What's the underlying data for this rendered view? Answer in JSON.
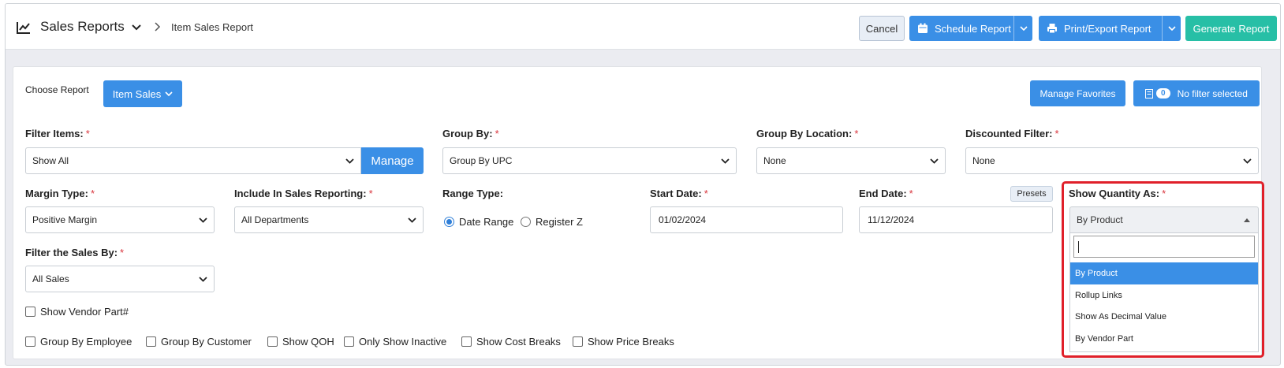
{
  "header": {
    "title": "Sales Reports",
    "breadcrumb": "Item Sales Report",
    "cancel_label": "Cancel",
    "schedule_label": "Schedule Report",
    "print_label": "Print/Export Report",
    "generate_label": "Generate Report"
  },
  "toolbar": {
    "choose_report_label": "Choose Report",
    "report_button": "Item Sales",
    "manage_favorites": "Manage Favorites",
    "filter_count": "0",
    "filter_status": "No filter selected"
  },
  "fields": {
    "filter_items": {
      "label": "Filter Items:",
      "value": "Show All",
      "manage": "Manage"
    },
    "group_by": {
      "label": "Group By:",
      "value": "Group By UPC"
    },
    "group_by_location": {
      "label": "Group By Location:",
      "value": "None"
    },
    "discounted_filter": {
      "label": "Discounted Filter:",
      "value": "None"
    },
    "margin_type": {
      "label": "Margin Type:",
      "value": "Positive Margin"
    },
    "include_in_sales": {
      "label": "Include In Sales Reporting:",
      "value": "All Departments"
    },
    "range_type": {
      "label": "Range Type:",
      "options": [
        "Date Range",
        "Register Z"
      ],
      "selected": "Date Range"
    },
    "start_date": {
      "label": "Start Date:",
      "value": "01/02/2024"
    },
    "end_date": {
      "label": "End Date:",
      "value": "11/12/2024",
      "presets": "Presets"
    },
    "show_quantity_as": {
      "label": "Show Quantity As:",
      "value": "By Product",
      "search_value": "",
      "options": [
        "By Product",
        "Rollup Links",
        "Show As Decimal Value",
        "By Vendor Part"
      ],
      "highlighted": "By Product"
    },
    "filter_sales_by": {
      "label": "Filter the Sales By:",
      "value": "All Sales"
    },
    "required_mark": "*"
  },
  "checkboxes": {
    "vendor_part": "Show Vendor Part#",
    "group_by_employee": "Group By Employee",
    "group_by_customer": "Group By Customer",
    "show_qoh": "Show QOH",
    "only_show_inactive": "Only Show Inactive",
    "show_cost_breaks": "Show Cost Breaks",
    "show_price_breaks": "Show Price Breaks"
  },
  "colors": {
    "primary": "#3a8fe6",
    "generate": "#27bfa6",
    "required": "#d9363e",
    "highlight": "#e0202a"
  }
}
